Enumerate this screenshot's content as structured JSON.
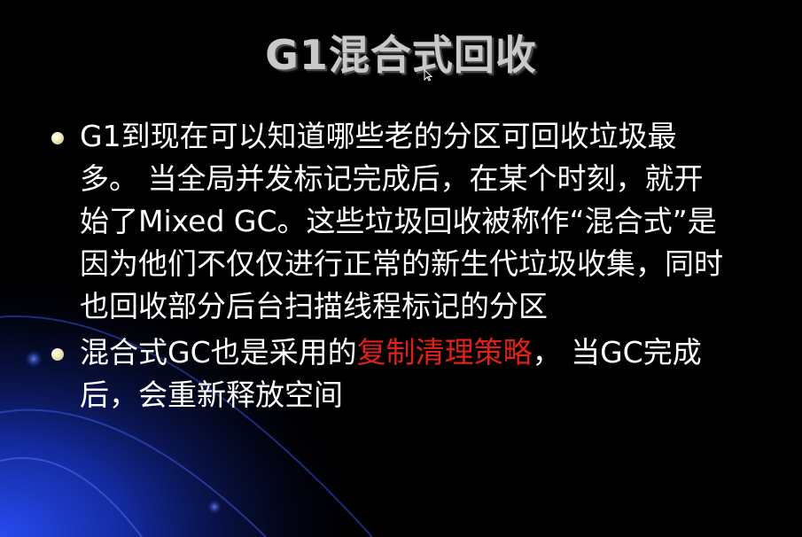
{
  "slide": {
    "title": "G1混合式回收",
    "bullets": [
      {
        "text": "G1到现在可以知道哪些老的分区可回收垃圾最多。 当全局并发标记完成后，在某个时刻，就开始了Mixed GC。这些垃圾回收被称作“混合式”是因为他们不仅仅进行正常的新生代垃圾收集，同时也回收部分后台扫描线程标记的分区"
      },
      {
        "text_before": "混合式GC也是采用的",
        "highlight": "复制清理策略",
        "text_after": "， 当GC完成后，会重新释放空间"
      }
    ]
  },
  "colors": {
    "background": "#000000",
    "title": "#c9c9c9",
    "body_text": "#ffffff",
    "highlight": "#e0201a",
    "accent_blue": "#1f3cc0"
  },
  "icons": {
    "bullet": "round-bullet-icon",
    "cursor": "mouse-pointer-icon"
  }
}
